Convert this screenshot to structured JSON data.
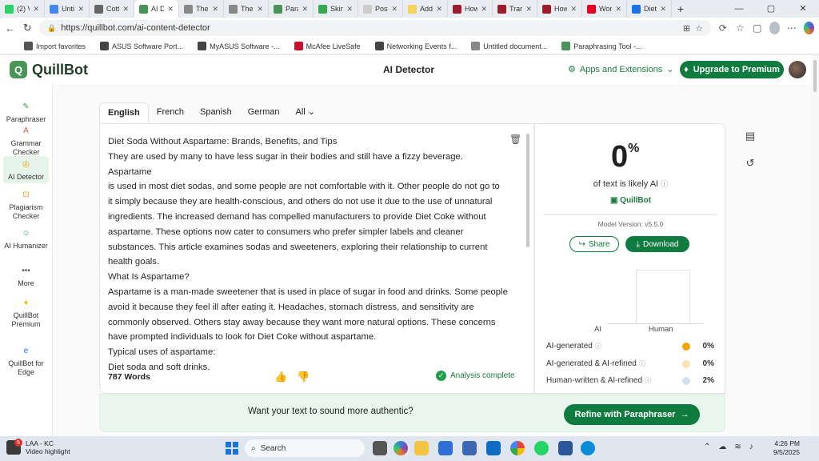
{
  "browser": {
    "tabs": [
      {
        "title": "(2) V",
        "color": "#25d366"
      },
      {
        "title": "Untit",
        "color": "#4285f4"
      },
      {
        "title": "Cotts",
        "color": "#666666"
      },
      {
        "title": "AI D",
        "color": "#499557",
        "active": true
      },
      {
        "title": "The",
        "color": "#888888"
      },
      {
        "title": "The",
        "color": "#888888"
      },
      {
        "title": "Para",
        "color": "#499557"
      },
      {
        "title": "Skin",
        "color": "#34a853"
      },
      {
        "title": "Post",
        "color": "#cccccc"
      },
      {
        "title": "Add",
        "color": "#f4d35e"
      },
      {
        "title": "How",
        "color": "#9c1c2c"
      },
      {
        "title": "Tran",
        "color": "#9c1c2c"
      },
      {
        "title": "How",
        "color": "#9c1c2c"
      },
      {
        "title": "Wor",
        "color": "#e60023"
      },
      {
        "title": "Diet",
        "color": "#1a73e8"
      }
    ],
    "url": "https://quillbot.com/ai-content-detector",
    "favorites": [
      {
        "label": "Import favorites",
        "color": "#555555"
      },
      {
        "label": "ASUS Software Port...",
        "color": "#444444"
      },
      {
        "label": "MyASUS Software -...",
        "color": "#444444"
      },
      {
        "label": "McAfee LiveSafe",
        "color": "#c8102e"
      },
      {
        "label": "Networking Events f...",
        "color": "#444444"
      },
      {
        "label": "Untitled document...",
        "color": "#888888"
      },
      {
        "label": "Paraphrasing Tool -...",
        "color": "#499557"
      }
    ]
  },
  "header": {
    "logo": "QuillBot",
    "title": "AI Detector",
    "apps": "Apps and Extensions",
    "upgrade": "Upgrade to Premium"
  },
  "rail": [
    {
      "label": "Paraphraser",
      "color": "#499557"
    },
    {
      "label": "Grammar Checker",
      "color": "#e05a47"
    },
    {
      "label": "AI Detector",
      "color": "#f4a300",
      "active": true
    },
    {
      "label": "Plagiarism Checker",
      "color": "#f39c12"
    },
    {
      "label": "AI Humanizer",
      "color": "#2e9f5a"
    },
    {
      "label": "More",
      "color": "#555555"
    },
    {
      "label": "QuillBot Premium",
      "color": "#f4b400"
    },
    {
      "label": "QuillBot for Edge",
      "color": "#1a73e8"
    }
  ],
  "langtabs": [
    "English",
    "French",
    "Spanish",
    "German",
    "All"
  ],
  "editor": {
    "lines": [
      "Diet Soda Without Aspartame: Brands, Benefits, and Tips",
      "They are used by many to have less sugar in their bodies and still have a fizzy beverage. Aspartame",
      "is used in most diet sodas, and some people are not comfortable with it. Other people do not go to",
      "it simply because they are health-conscious, and others do not use it due to the use of unnatural",
      "ingredients. The increased demand has compelled manufacturers to provide Diet Coke without",
      "aspartame. These options now cater to consumers who prefer simpler labels and cleaner",
      "substances. This article examines sodas and sweeteners, exploring their relationship to current",
      "health goals.",
      "What Is Aspartame?",
      "Aspartame is a man-made sweetener that is used in place of sugar in food and drinks. Some people",
      "avoid it because they feel ill after eating it. Headaches, stomach distress, and sensitivity are",
      "commonly observed. Others stay away because they want more natural options. These concerns",
      "have prompted individuals to look for Diet Coke without aspartame.",
      "Typical uses of aspartame:",
      "Diet soda and soft drinks."
    ],
    "word_count": "787 Words",
    "status": "Analysis complete"
  },
  "results": {
    "percent": "0",
    "percent_sign": "%",
    "likely": "of text is likely AI",
    "badge": "QuillBot",
    "version": "Model Version: v5.5.0",
    "share": "Share",
    "download": "Download",
    "chart_labels": [
      "AI",
      "Human"
    ],
    "ai_fraction": 0,
    "human_fraction": 1,
    "legend": [
      {
        "label": "AI-generated",
        "value": "0%",
        "color": "#f4a300"
      },
      {
        "label": "AI-generated & AI-refined",
        "value": "0%",
        "color": "#f6e2b3"
      },
      {
        "label": "Human-written & AI-refined",
        "value": "2%",
        "color": "#cfe0f1"
      }
    ]
  },
  "cta": {
    "text": "Want your text to sound more authentic?",
    "button": "Refine with Paraphraser"
  },
  "taskbar": {
    "notif_count": "5",
    "widget_title": "LAA - KC",
    "widget_sub": "Video highlight",
    "search": "Search",
    "time": "4:26 PM",
    "date": "9/5/2025"
  }
}
